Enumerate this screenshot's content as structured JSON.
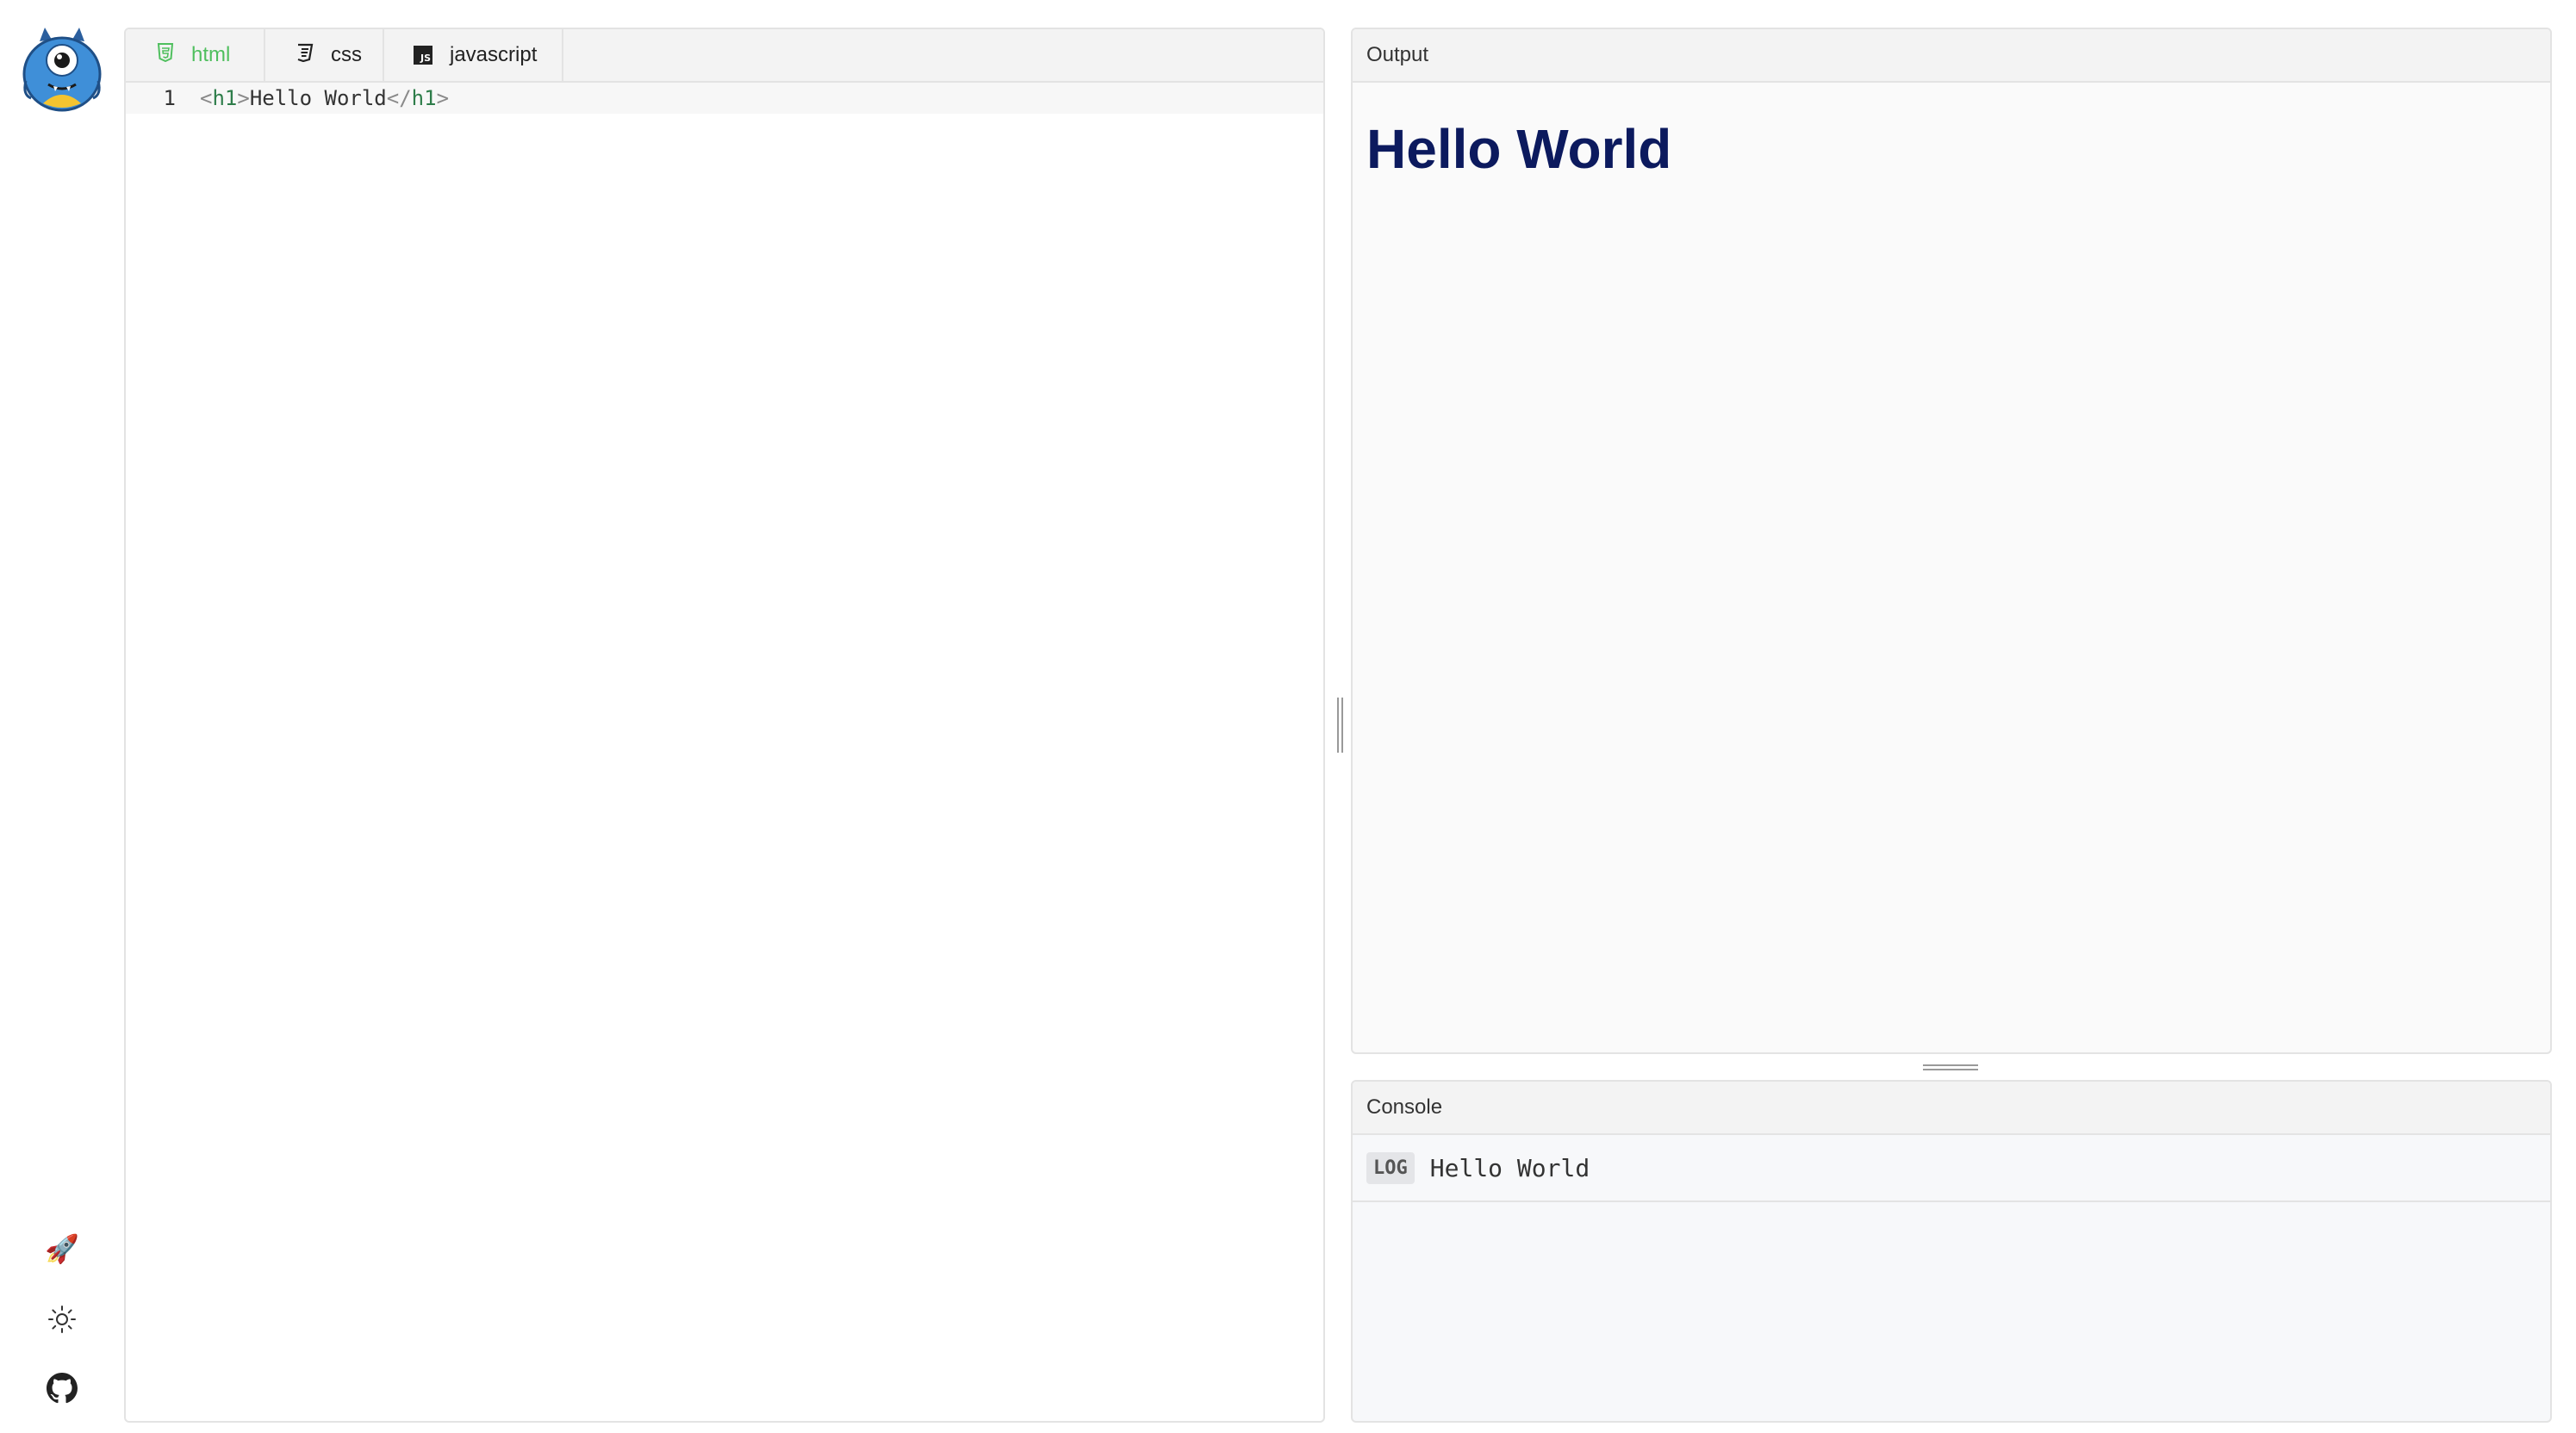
{
  "app": {
    "logo": "one-eyed-monster-logo",
    "rail_icons": [
      "rocket-icon",
      "sun-icon",
      "github-icon"
    ],
    "rocket_glyph": "🚀"
  },
  "editor": {
    "tabs": [
      {
        "label": "html",
        "icon": "html5-icon",
        "active": true
      },
      {
        "label": "css",
        "icon": "css3-icon",
        "active": false
      },
      {
        "label": "javascript",
        "icon": "js-icon",
        "active": false
      }
    ],
    "js_badge": "JS",
    "lines": [
      {
        "number": "1",
        "open_lt": "<",
        "open_tag": "h1",
        "open_gt": ">",
        "text": "Hello World",
        "close_lt": "</",
        "close_tag": "h1",
        "close_gt": ">"
      }
    ]
  },
  "output": {
    "title": "Output",
    "heading": "Hello World"
  },
  "console": {
    "title": "Console",
    "entries": [
      {
        "level": "LOG",
        "message": "Hello World"
      }
    ]
  },
  "colors": {
    "active_tab": "#4fbf5e",
    "output_heading": "#0c1a5e",
    "panel_border": "#e3e3e3",
    "header_bg": "#f3f3f3"
  }
}
